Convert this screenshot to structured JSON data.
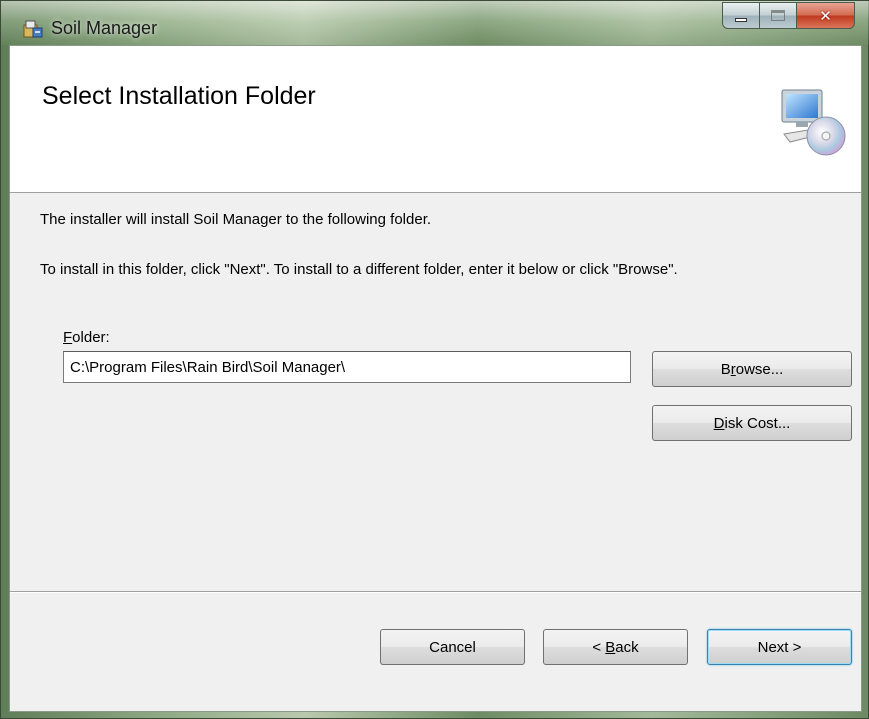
{
  "window": {
    "title": "Soil Manager",
    "caption_buttons": {
      "minimize": "minimize-icon",
      "maximize": "maximize-icon",
      "close": "close-icon"
    },
    "title_icon": "installer-package-icon"
  },
  "banner": {
    "title": "Select Installation Folder",
    "icon": "computer-disc-icon"
  },
  "body": {
    "line1": "The installer will install Soil Manager to the following folder.",
    "line2": "To install in this folder, click \"Next\". To install to a different folder, enter it below or click \"Browse\"."
  },
  "folder": {
    "label_underline": "F",
    "label_rest": "older:",
    "value": "C:\\Program Files\\Rain Bird\\Soil Manager\\"
  },
  "buttons": {
    "browse": {
      "pre": "B",
      "under": "r",
      "post": "owse..."
    },
    "disk_cost": {
      "pre": "",
      "under": "D",
      "post": "isk Cost..."
    },
    "cancel": "Cancel",
    "back": {
      "pre": "< ",
      "under": "B",
      "post": "ack"
    },
    "next": "Next >"
  },
  "colors": {
    "client_bg": "#f0f0f0",
    "banner_bg": "#ffffff",
    "close_red": "#c0391f",
    "default_button_border": "#3c7fb1"
  }
}
